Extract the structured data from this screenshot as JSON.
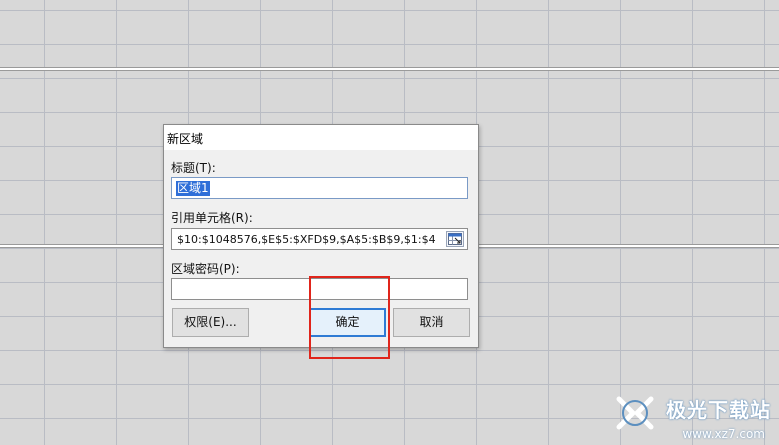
{
  "dialog": {
    "title": "新区域",
    "name_label": "标题(T):",
    "name_value": "区域1",
    "ref_label": "引用单元格(R):",
    "ref_value": "$10:$1048576,$E$5:$XFD$9,$A$5:$B$9,$1:$4",
    "password_label": "区域密码(P):",
    "password_value": "",
    "permissions_button": "权限(E)...",
    "ok_button": "确定",
    "cancel_button": "取消"
  },
  "watermark": {
    "brand": "极光下载站",
    "url": "www.xz7.com"
  },
  "colors": {
    "highlight": "#e0251b",
    "selection": "#2f6fd8",
    "default_button_border": "#2f7bd4"
  }
}
